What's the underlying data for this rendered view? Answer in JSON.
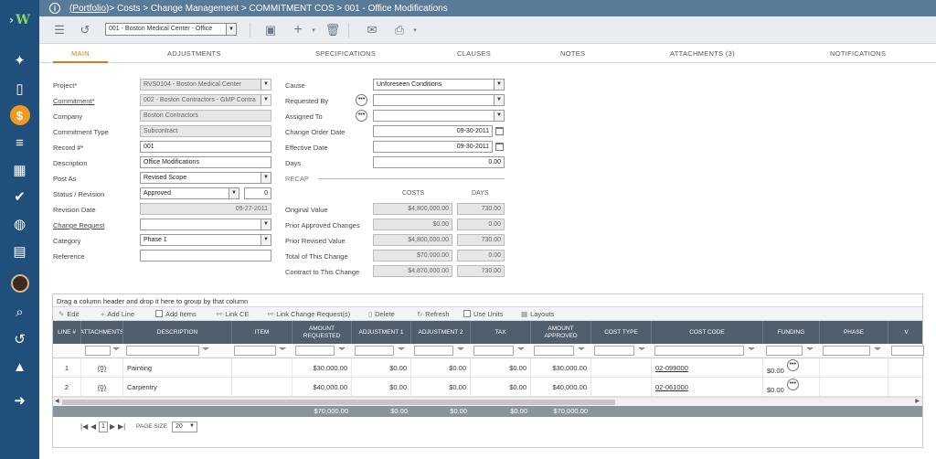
{
  "breadcrumb": {
    "portfolio": "(Portfolio)",
    "path": " > Costs > Change Management > COMMITMENT COS > 001 - Office Modifications"
  },
  "toolbar": {
    "record_selector": "001 - Boston Medical Center - Office"
  },
  "tabs": [
    "MAIN",
    "ADJUSTMENTS",
    "SPECIFICATIONS",
    "CLAUSES",
    "NOTES",
    "ATTACHMENTS (3)",
    "NOTIFICATIONS"
  ],
  "form": {
    "project_label": "Project*",
    "project_value": "RVS0104 - Boston Medical Center",
    "commitment_label": "Commitment*",
    "commitment_value": "002 - Boston Contractors - GMP Contra",
    "company_label": "Company",
    "company_value": "Boston Contractors",
    "commitment_type_label": "Commitment Type",
    "commitment_type_value": "Subcontract",
    "record_label": "Record #*",
    "record_value": "001",
    "description_label": "Description",
    "description_value": "Office Modifications",
    "post_as_label": "Post As",
    "post_as_value": "Revised Scope",
    "status_label": "Status / Revision",
    "status_value": "Approved",
    "revision_value": "0",
    "revision_date_label": "Revision Date",
    "revision_date_value": "09-27-2011",
    "change_request_label": "Change Request",
    "change_request_value": "",
    "category_label": "Category",
    "category_value": "Phase 1",
    "reference_label": "Reference",
    "reference_value": "",
    "cause_label": "Cause",
    "cause_value": "Unforeseen Conditions",
    "requested_by_label": "Requested By",
    "assigned_to_label": "Assigned To",
    "change_order_date_label": "Change Order Date",
    "change_order_date_value": "09-30-2011",
    "effective_date_label": "Effective Date",
    "effective_date_value": "09-30-2011",
    "days_label": "Days",
    "days_value": "0.00"
  },
  "recap": {
    "title": "RECAP",
    "costs_header": "COSTS",
    "days_header": "DAYS",
    "rows": [
      {
        "label": "Original Value",
        "costs": "$4,800,000.00",
        "days": "730.00"
      },
      {
        "label": "Prior Approved Changes",
        "costs": "$0.00",
        "days": "0.00"
      },
      {
        "label": "Prior Revised Value",
        "costs": "$4,800,000.00",
        "days": "730.00"
      },
      {
        "label": "Total of This Change",
        "costs": "$70,000.00",
        "days": "0.00"
      },
      {
        "label": "Contract to This Change",
        "costs": "$4,870,000.00",
        "days": "730.00"
      }
    ]
  },
  "grid": {
    "group_hint": "Drag a column header and drop it here to group by that column",
    "tools": {
      "edit": "Edit",
      "add_line": "Add Line",
      "add_items": "Add Items",
      "link_ce": "Link CE",
      "link_cr": "Link Change Request(s)",
      "delete": "Delete",
      "refresh": "Refresh",
      "use_units": "Use Units",
      "layouts": "Layouts"
    },
    "headers": {
      "line": "LINE #",
      "attach": "ATTACHMENTS",
      "description": "DESCRIPTION",
      "item": "ITEM",
      "amount_requested": "AMOUNT REQUESTED",
      "adj1": "ADJUSTMENT 1",
      "adj2": "ADJUSTMENT 2",
      "tax": "TAX",
      "amount_approved": "AMOUNT APPROVED",
      "cost_type": "COST TYPE",
      "cost_code": "COST CODE",
      "funding": "FUNDING",
      "phase": "PHASE",
      "extra": "V"
    },
    "rows": [
      {
        "line": "1",
        "attach": "(0)",
        "description": "Painting",
        "item": "",
        "amount_requested": "$30,000.00",
        "adj1": "$0.00",
        "adj2": "$0.00",
        "tax": "$0.00",
        "amount_approved": "$30,000.00",
        "cost_type": "",
        "cost_code": "02-099000",
        "funding": "$0.00",
        "phase": ""
      },
      {
        "line": "2",
        "attach": "(0)",
        "description": "Carpentry",
        "item": "",
        "amount_requested": "$40,000.00",
        "adj1": "$0.00",
        "adj2": "$0.00",
        "tax": "$0.00",
        "amount_approved": "$40,000.00",
        "cost_type": "",
        "cost_code": "02-061000",
        "funding": "$0.00",
        "phase": ""
      }
    ],
    "totals": {
      "amount_requested": "$70,000.00",
      "adj1": "$0.00",
      "adj2": "$0.00",
      "tax": "$0.00",
      "amount_approved": "$70,000.00"
    },
    "pager": {
      "page": "1",
      "page_size_label": "PAGE SIZE",
      "page_size": "20"
    }
  },
  "colors": {
    "sidebar": "#1f4f7a",
    "topbar": "#5a7b98",
    "accent": "#e07a1a",
    "grid_header": "#4f5f6e"
  }
}
